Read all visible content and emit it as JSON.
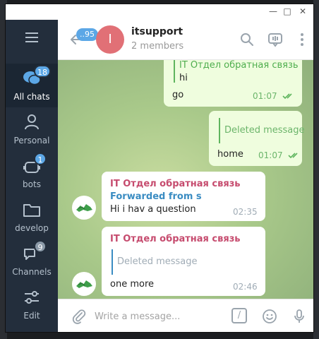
{
  "window": {
    "minimize_glyph": "—",
    "maximize_glyph": "□",
    "close_glyph": "✕"
  },
  "sidebar": {
    "items": [
      {
        "label": "All chats",
        "badge": "18",
        "icon": "chat-bubbles-icon"
      },
      {
        "label": "Personal",
        "badge": "",
        "icon": "person-icon"
      },
      {
        "label": "bots",
        "badge": "1",
        "icon": "bot-icon"
      },
      {
        "label": "develop",
        "badge": "",
        "icon": "folder-icon"
      },
      {
        "label": "Channels",
        "badge": "9",
        "icon": "channel-bubbles-icon"
      },
      {
        "label": "Edit",
        "badge": "",
        "icon": "sliders-icon"
      }
    ]
  },
  "header": {
    "back_badge": "..95",
    "avatar_letter": "I",
    "title": "itsupport",
    "subtitle": "2 members",
    "icons": [
      "search-icon",
      "voice-chat-icon",
      "more-vertical-icon"
    ]
  },
  "messages": [
    {
      "direction": "out",
      "reply_title": "IT Отдел обратная связь",
      "reply_text": "hi",
      "text": "go",
      "time": "01:07"
    },
    {
      "direction": "out",
      "reply_text": "Deleted message",
      "text": "home",
      "time": "01:07"
    },
    {
      "direction": "in",
      "sender": "IT Отдел обратная связь",
      "forwarded": "Forwarded from s",
      "text": "Hi i hav a question",
      "time": "02:35"
    },
    {
      "direction": "in",
      "sender": "IT Отдел обратная связь",
      "reply_text": "Deleted message",
      "text": "one more",
      "time": "02:46"
    }
  ],
  "composer": {
    "placeholder": "Write a message...",
    "command_glyph": "/"
  },
  "colors": {
    "sidebar_bg": "#232e3c",
    "accent": "#5ca7e6",
    "avatar": "#e17076",
    "outgoing_bubble": "#effdde",
    "sender_name": "#c64b6e",
    "forwarded": "#3a8cc2"
  }
}
